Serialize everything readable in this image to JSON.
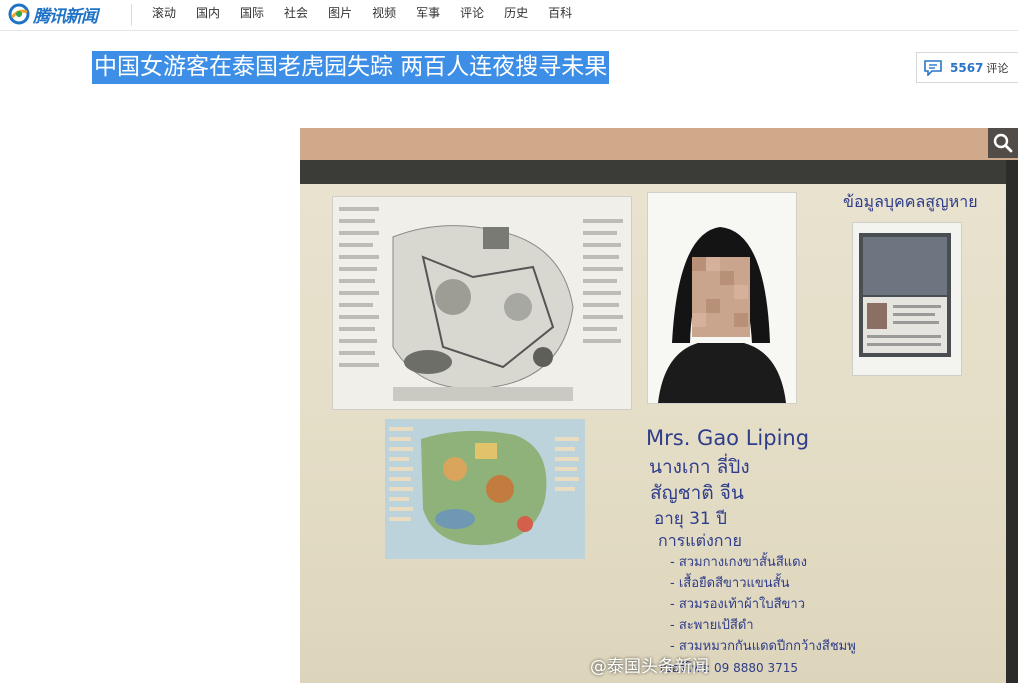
{
  "header": {
    "logo_text": "腾讯新闻",
    "nav": [
      "滚动",
      "国内",
      "国际",
      "社会",
      "图片",
      "视频",
      "军事",
      "评论",
      "历史",
      "百科"
    ]
  },
  "article": {
    "title": "中国女游客在泰国老虎园失踪 两百人连夜搜寻未果",
    "comment_count": "5567",
    "comment_label": "评论"
  },
  "photo": {
    "board_heading": "ข้อมูลบุคคลสูญหาย",
    "name_en": "Mrs. Gao Liping",
    "name_th": "นางเกา ลี่ปิง",
    "nationality": "สัญชาติ จีน",
    "age": "อายุ 31 ปี",
    "clothing_heading": "การแต่งกาย",
    "clothing_items": [
      "- สวมกางเกงขาสั้นสีแดง",
      "- เสื้อยืดสีขาวแขนสั้น",
      "- สวมรองเท้าผ้าใบสีขาว",
      "- สะพายเป้สีดำ",
      "- สวมหมวกกันแดดปีกกว้างสีชมพู"
    ],
    "phone": "เบอร์โทร: 09 8880 3715",
    "watermark": "@泰国头条新闻"
  },
  "icons": {
    "comment": "speech-bubble-icon",
    "zoom": "magnifier-icon"
  },
  "colors": {
    "accent": "#1f73c6",
    "headline_highlight": "#3d8ee6",
    "comment_count": "#2a74c9"
  }
}
